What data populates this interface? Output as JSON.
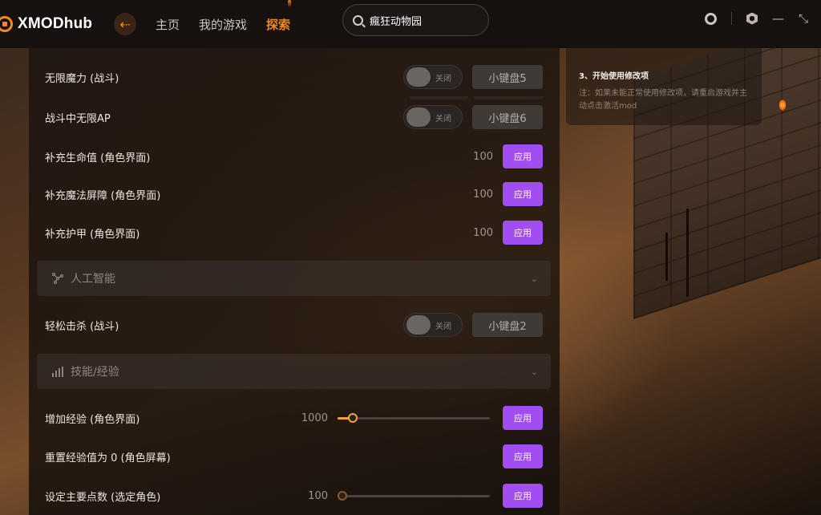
{
  "app": {
    "logo_text": "XMODhub",
    "nav": [
      "主页",
      "我的游戏",
      "探索"
    ],
    "active_nav_index": 2,
    "accent": "#f08a1c",
    "search_value": "瘋狂动物园"
  },
  "info_card": {
    "step": "3、开始使用修改项",
    "note": "注：如果未能正常使用修改项，请重启游戏并主动点击激活mod"
  },
  "toggle_off_label": "关闭",
  "apply_label": "应用",
  "rows": {
    "infinite_mana": {
      "label": "无限魔力 (战斗)",
      "hotkey": "小键盘5"
    },
    "infinite_ap": {
      "label": "战斗中无限AP",
      "hotkey": "小键盘6"
    },
    "refill_hp": {
      "label": "补充生命值 (角色界面)",
      "value": "100"
    },
    "refill_barrier": {
      "label": "补充魔法屏障 (角色界面)",
      "value": "100"
    },
    "refill_armor": {
      "label": "补充护甲 (角色界面)",
      "value": "100"
    },
    "easy_kill": {
      "label": "轻松击杀 (战斗)",
      "hotkey": "小键盘2"
    },
    "add_exp": {
      "label": "增加经验 (角色界面)",
      "value": "1000",
      "slider_fraction": 0.1
    },
    "reset_exp": {
      "label": "重置经验值为 0 (角色屏幕)"
    },
    "main_points": {
      "label": "设定主要点数 (选定角色)",
      "value": "100",
      "slider_fraction": 0.0
    }
  },
  "sections": {
    "ai": {
      "title": "人工智能",
      "icon": "ai-nodes-icon"
    },
    "skills": {
      "title": "技能/经验",
      "icon": "bar-chart-icon"
    }
  },
  "colors": {
    "apply_button": "#a04ef0",
    "slider": "#f0a23c"
  }
}
